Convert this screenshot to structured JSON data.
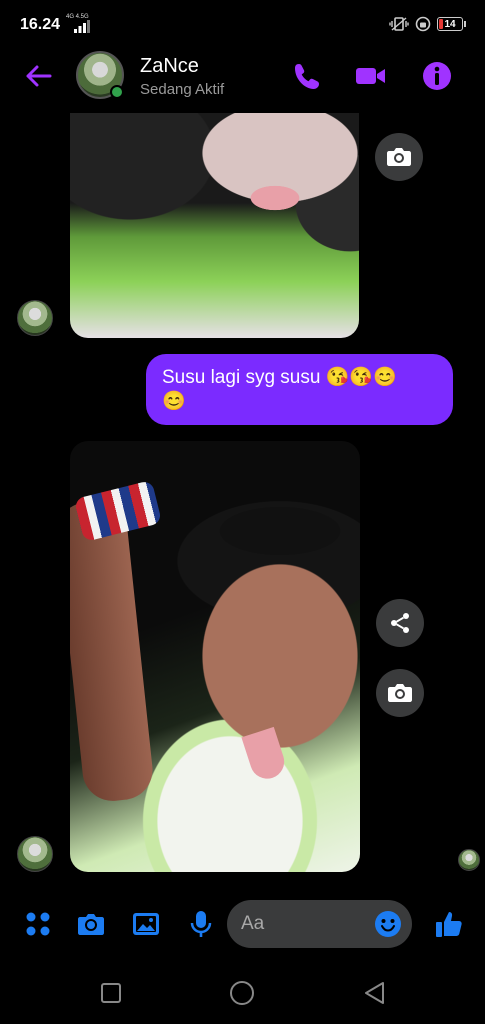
{
  "status_bar": {
    "time": "16.24",
    "network": "4G 4.5G",
    "battery": "14"
  },
  "header": {
    "contact_name": "ZaNce",
    "contact_status": "Sedang Aktif"
  },
  "messages": [
    {
      "type": "photo",
      "sender": "contact"
    },
    {
      "type": "text",
      "sender": "me",
      "text": "Susu lagi syg susu 😘😘😊\n😊"
    },
    {
      "type": "photo",
      "sender": "contact"
    }
  ],
  "composer": {
    "placeholder": "Aa"
  },
  "colors": {
    "accent": "#a033ff",
    "bubble": "#7b2bff",
    "composer_icons": "#1c7cf2",
    "online": "#31a24c"
  },
  "icons": {
    "back": "arrow-left-icon",
    "call": "phone-icon",
    "video": "video-camera-icon",
    "info": "info-icon",
    "photo_camera": "camera-icon",
    "share": "share-icon",
    "menu": "four-dots-icon",
    "gallery": "image-icon",
    "mic": "microphone-icon",
    "emoji": "smiley-icon",
    "like": "thumbs-up-icon"
  }
}
